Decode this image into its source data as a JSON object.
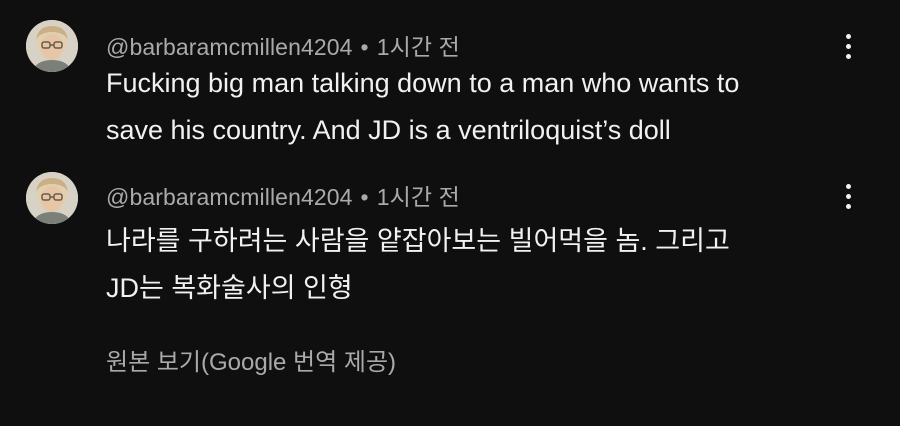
{
  "comments": [
    {
      "author": "@barbaramcmillen4204",
      "separator": "•",
      "time": "1시간 전",
      "lines": [
        "Fucking big man talking down to a man who wants to",
        "save his country. And JD is a ventriloquist’s doll"
      ],
      "icons": {
        "avatar": "profile-photo",
        "menu": "vertical-ellipsis-icon"
      }
    },
    {
      "author": "@barbaramcmillen4204",
      "separator": "•",
      "time": "1시간 전",
      "lines": [
        "나라를 구하려는 사람을 얕잡아보는 빌어먹을 놈. 그리고",
        "JD는 복화술사의 인형"
      ],
      "icons": {
        "avatar": "profile-photo",
        "menu": "vertical-ellipsis-icon"
      }
    }
  ],
  "see_original_label": "원본 보기(Google 번역 제공)",
  "colors": {
    "background": "#0f0f0f",
    "primary_text": "#f1f1f1",
    "secondary_text": "#aaaaaa"
  }
}
